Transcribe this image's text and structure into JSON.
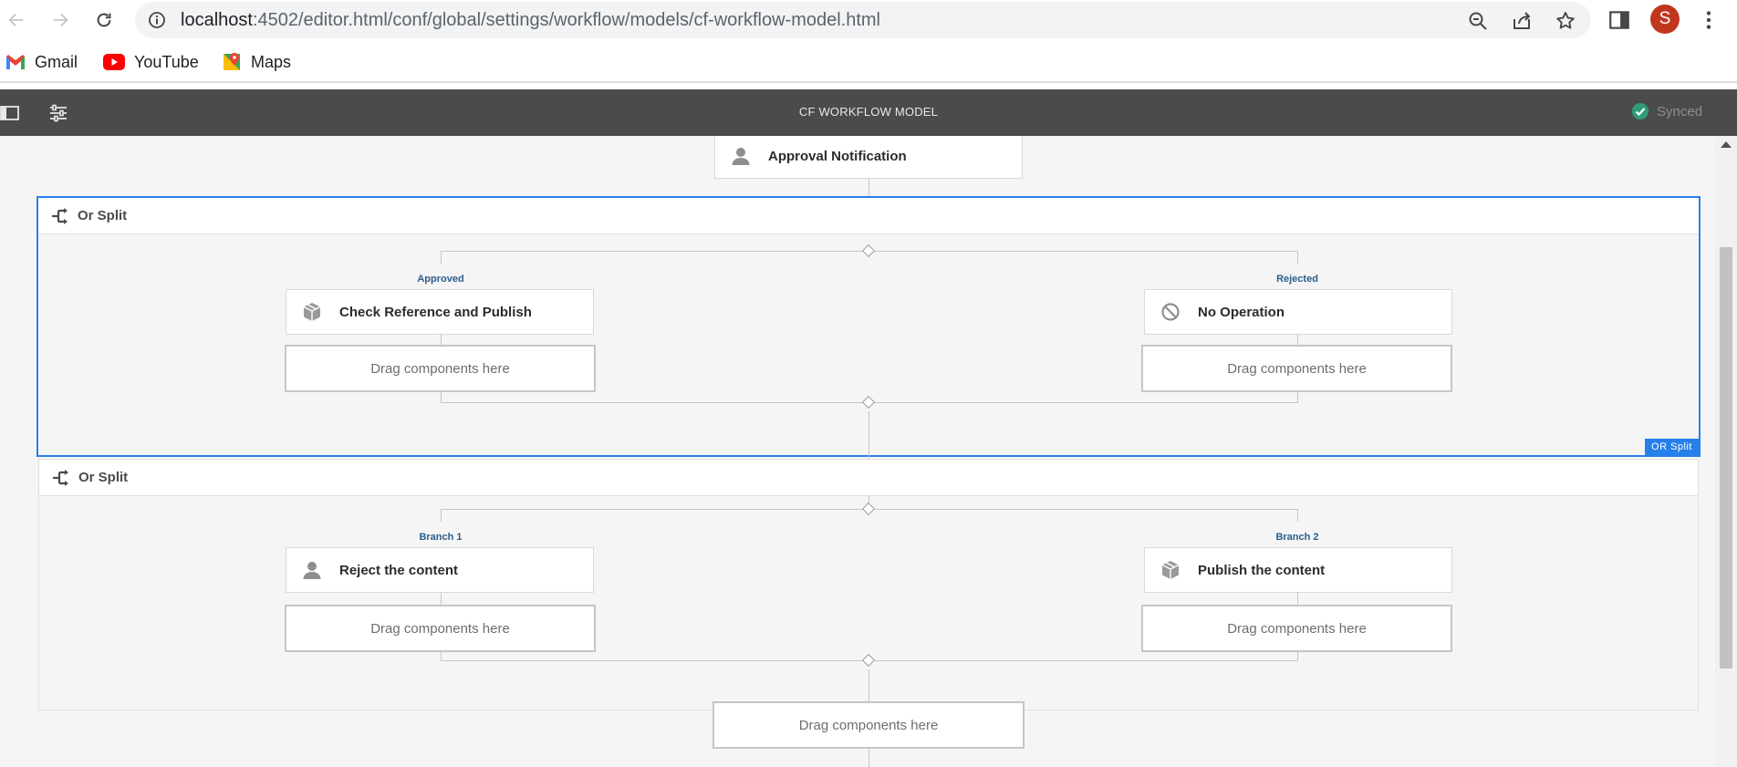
{
  "browser": {
    "url_host": "localhost",
    "url_path": ":4502/editor.html/conf/global/settings/workflow/models/cf-workflow-model.html",
    "profile_initial": "S",
    "bookmarks": [
      {
        "label": "Gmail",
        "icon": "gmail-icon"
      },
      {
        "label": "YouTube",
        "icon": "youtube-icon"
      },
      {
        "label": "Maps",
        "icon": "maps-icon"
      }
    ]
  },
  "header": {
    "title": "CF WORKFLOW MODEL",
    "status": "Synced"
  },
  "workflow": {
    "top_step": {
      "label": "Approval Notification",
      "icon": "user-icon"
    },
    "splits": [
      {
        "label": "Or Split",
        "badge": "OR Split",
        "selected": true,
        "branches": [
          {
            "label": "Approved",
            "step": "Check Reference and Publish",
            "icon": "package-icon",
            "drop": "Drag components here"
          },
          {
            "label": "Rejected",
            "step": "No Operation",
            "icon": "no-operation-icon",
            "drop": "Drag components here"
          }
        ]
      },
      {
        "label": "Or Split",
        "selected": false,
        "branches": [
          {
            "label": "Branch 1",
            "step": "Reject the content",
            "icon": "user-icon",
            "drop": "Drag components here"
          },
          {
            "label": "Branch 2",
            "step": "Publish the content",
            "icon": "package-icon",
            "drop": "Drag components here"
          }
        ]
      }
    ],
    "bottom_drop": "Drag components here"
  },
  "colors": {
    "header_bg": "#4b4b4b",
    "selection_blue": "#2680eb",
    "synced_green": "#2d9d78",
    "branch_label": "#2b5d8a"
  }
}
